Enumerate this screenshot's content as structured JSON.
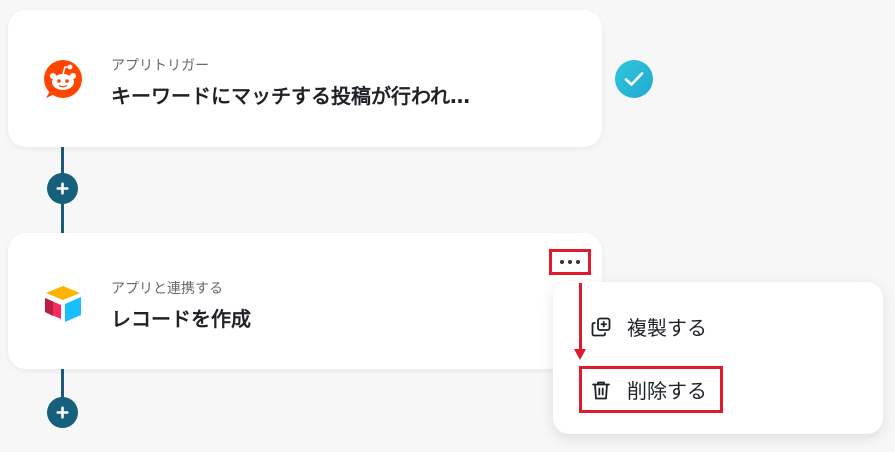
{
  "flow": {
    "steps": [
      {
        "subtitle": "アプリトリガー",
        "title": "キーワードにマッチする投稿が行われ…",
        "app_icon": "reddit-logo-icon",
        "status_icon": "check-icon"
      },
      {
        "subtitle": "アプリと連携する",
        "title": "レコードを作成",
        "app_icon": "airtable-logo-icon",
        "more_icon": "more-horizontal-icon"
      }
    ],
    "add_icon": "plus-icon"
  },
  "context_menu": {
    "items": [
      {
        "label": "複製する",
        "icon": "duplicate-icon"
      },
      {
        "label": "削除する",
        "icon": "trash-icon"
      }
    ]
  },
  "colors": {
    "connector": "#1f5a78",
    "add_button": "#17607d",
    "check_badge": "#2ec7dc",
    "highlight": "#e0192c",
    "reddit": "#ff4500",
    "background": "#f7f7f8"
  }
}
